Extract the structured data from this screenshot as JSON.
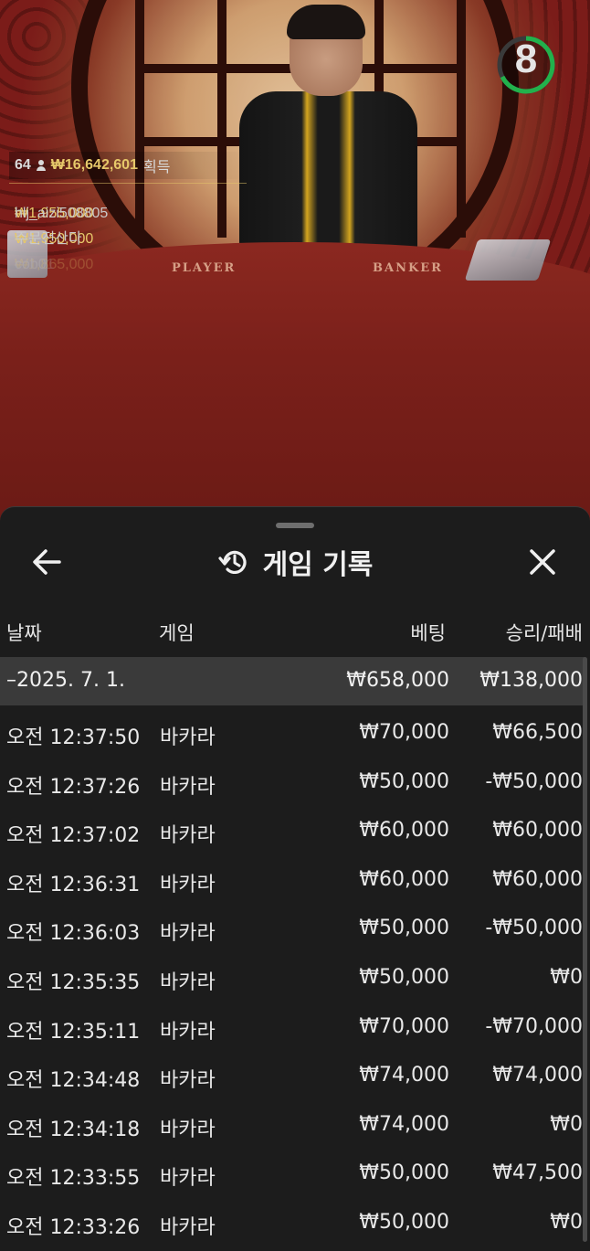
{
  "live": {
    "timer": "8",
    "table_labels": {
      "player": "PLAYER",
      "banker": "BANKER"
    },
    "winners": {
      "count": "64",
      "total": "₩16,642,601",
      "won_label": "획득",
      "list": [
        {
          "amount": "₩1,955,000",
          "name": "hlj_aizi508805"
        },
        {
          "amount": "₩1,950,000",
          "name": "주문전산다"
        },
        {
          "amount": "₩1,865,000",
          "name": "cob01"
        }
      ]
    }
  },
  "history": {
    "title": "게임 기록",
    "columns": {
      "date": "날짜",
      "game": "게임",
      "bet": "베팅",
      "result": "승리/패배"
    },
    "day": {
      "date": "–2025. 7. 1.",
      "bet": "₩658,000",
      "result": "₩138,000"
    },
    "rows": [
      {
        "time": "오전 12:37:50",
        "game": "바카라",
        "bet": "₩70,000",
        "result": "₩66,500"
      },
      {
        "time": "오전 12:37:26",
        "game": "바카라",
        "bet": "₩50,000",
        "result": "-₩50,000"
      },
      {
        "time": "오전 12:37:02",
        "game": "바카라",
        "bet": "₩60,000",
        "result": "₩60,000"
      },
      {
        "time": "오전 12:36:31",
        "game": "바카라",
        "bet": "₩60,000",
        "result": "₩60,000"
      },
      {
        "time": "오전 12:36:03",
        "game": "바카라",
        "bet": "₩50,000",
        "result": "-₩50,000"
      },
      {
        "time": "오전 12:35:35",
        "game": "바카라",
        "bet": "₩50,000",
        "result": "₩0"
      },
      {
        "time": "오전 12:35:11",
        "game": "바카라",
        "bet": "₩70,000",
        "result": "-₩70,000"
      },
      {
        "time": "오전 12:34:48",
        "game": "바카라",
        "bet": "₩74,000",
        "result": "₩74,000"
      },
      {
        "time": "오전 12:34:18",
        "game": "바카라",
        "bet": "₩74,000",
        "result": "₩0"
      },
      {
        "time": "오전 12:33:55",
        "game": "바카라",
        "bet": "₩50,000",
        "result": "₩47,500"
      },
      {
        "time": "오전 12:33:26",
        "game": "바카라",
        "bet": "₩50,000",
        "result": "₩0"
      }
    ]
  },
  "colors": {
    "accent_gold": "#e6c86a",
    "timer_green": "#22b14c",
    "sheet_bg": "#1c1c1c"
  },
  "icons": {
    "back": "arrow-left-icon",
    "history": "history-icon",
    "close": "close-icon"
  }
}
